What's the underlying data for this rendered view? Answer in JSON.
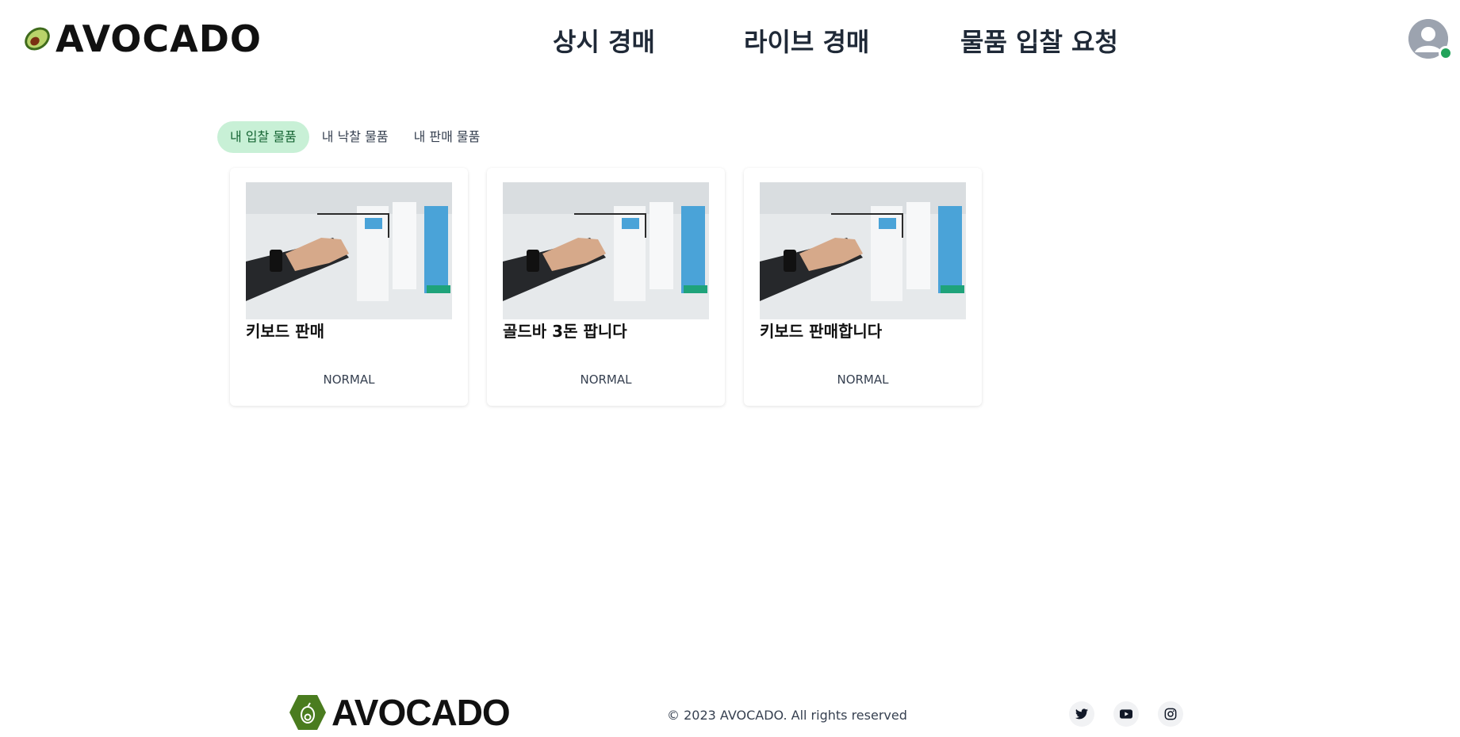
{
  "header": {
    "logo_text": "AVOCADO",
    "nav": [
      {
        "label": "상시 경매"
      },
      {
        "label": "라이브 경매"
      },
      {
        "label": "물품 입찰 요청"
      }
    ]
  },
  "tabs": [
    {
      "label": "내 입찰 물품",
      "active": true
    },
    {
      "label": "내 낙찰 물품",
      "active": false
    },
    {
      "label": "내 판매 물품",
      "active": false
    }
  ],
  "cards": [
    {
      "title": "키보드 판매",
      "status": "NORMAL"
    },
    {
      "title": "골드바 3돈 팝니다",
      "status": "NORMAL"
    },
    {
      "title": "키보드 판매합니다",
      "status": "NORMAL"
    }
  ],
  "footer": {
    "logo_text": "AVOCADO",
    "copyright": "© 2023 AVOCADO. All rights reserved",
    "social": [
      "twitter-icon",
      "youtube-icon",
      "instagram-icon"
    ]
  },
  "colors": {
    "accent_green": "#22a35a",
    "tab_active_bg": "#c8f0d6",
    "tab_active_text": "#166534",
    "logo_green": "#4a7c1f"
  }
}
